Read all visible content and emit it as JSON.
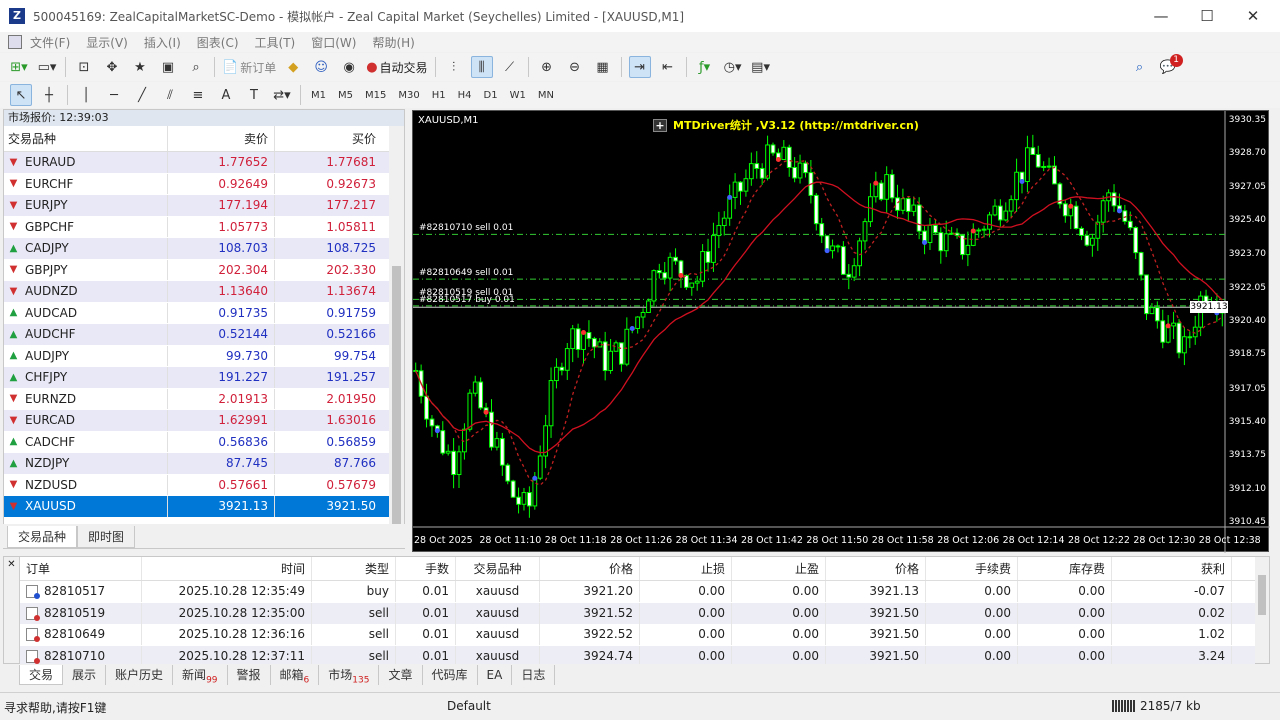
{
  "window": {
    "title": "500045169: ZealCapitalMarketSC-Demo - 模拟帐户 - Zeal Capital Market (Seychelles) Limited - [XAUUSD,M1]"
  },
  "menu": [
    "文件(F)",
    "显示(V)",
    "插入(I)",
    "图表(C)",
    "工具(T)",
    "窗口(W)",
    "帮助(H)"
  ],
  "toolbar": {
    "new_order": "新订单",
    "auto_trading": "自动交易"
  },
  "timeframes": [
    "M1",
    "M5",
    "M15",
    "M30",
    "H1",
    "H4",
    "D1",
    "W1",
    "MN"
  ],
  "market_watch": {
    "title": "市场报价: 12:39:03",
    "headers": {
      "symbol": "交易品种",
      "bid": "卖价",
      "ask": "买价"
    },
    "rows": [
      {
        "symbol": "EURAUD",
        "bid": "1.77652",
        "ask": "1.77681",
        "dir": "down",
        "color": "red"
      },
      {
        "symbol": "EURCHF",
        "bid": "0.92649",
        "ask": "0.92673",
        "dir": "down",
        "color": "red"
      },
      {
        "symbol": "EURJPY",
        "bid": "177.194",
        "ask": "177.217",
        "dir": "down",
        "color": "red"
      },
      {
        "symbol": "GBPCHF",
        "bid": "1.05773",
        "ask": "1.05811",
        "dir": "down",
        "color": "red"
      },
      {
        "symbol": "CADJPY",
        "bid": "108.703",
        "ask": "108.725",
        "dir": "up",
        "color": "blue"
      },
      {
        "symbol": "GBPJPY",
        "bid": "202.304",
        "ask": "202.330",
        "dir": "down",
        "color": "red"
      },
      {
        "symbol": "AUDNZD",
        "bid": "1.13640",
        "ask": "1.13674",
        "dir": "down",
        "color": "red"
      },
      {
        "symbol": "AUDCAD",
        "bid": "0.91735",
        "ask": "0.91759",
        "dir": "up",
        "color": "blue"
      },
      {
        "symbol": "AUDCHF",
        "bid": "0.52144",
        "ask": "0.52166",
        "dir": "up",
        "color": "blue"
      },
      {
        "symbol": "AUDJPY",
        "bid": "99.730",
        "ask": "99.754",
        "dir": "up",
        "color": "blue"
      },
      {
        "symbol": "CHFJPY",
        "bid": "191.227",
        "ask": "191.257",
        "dir": "up",
        "color": "blue"
      },
      {
        "symbol": "EURNZD",
        "bid": "2.01913",
        "ask": "2.01950",
        "dir": "down",
        "color": "red"
      },
      {
        "symbol": "EURCAD",
        "bid": "1.62991",
        "ask": "1.63016",
        "dir": "down",
        "color": "red"
      },
      {
        "symbol": "CADCHF",
        "bid": "0.56836",
        "ask": "0.56859",
        "dir": "up",
        "color": "blue"
      },
      {
        "symbol": "NZDJPY",
        "bid": "87.745",
        "ask": "87.766",
        "dir": "up",
        "color": "blue"
      },
      {
        "symbol": "NZDUSD",
        "bid": "0.57661",
        "ask": "0.57679",
        "dir": "down",
        "color": "red"
      },
      {
        "symbol": "XAUUSD",
        "bid": "3921.13",
        "ask": "3921.50",
        "dir": "down",
        "color": "sel"
      }
    ],
    "tabs": [
      "交易品种",
      "即时图"
    ]
  },
  "chart": {
    "label": "XAUUSD,M1",
    "indicator": "MTDriver统计 ,V3.12 (http://mtdriver.cn)",
    "current_price": "3921.13",
    "y_ticks": [
      "3930.35",
      "3928.70",
      "3927.05",
      "3925.40",
      "3923.70",
      "3922.05",
      "3920.40",
      "3918.75",
      "3917.05",
      "3915.40",
      "3913.75",
      "3912.10",
      "3910.45"
    ],
    "x_ticks": [
      "28 Oct 2025",
      "28 Oct 11:10",
      "28 Oct 11:18",
      "28 Oct 11:26",
      "28 Oct 11:34",
      "28 Oct 11:42",
      "28 Oct 11:50",
      "28 Oct 11:58",
      "28 Oct 12:06",
      "28 Oct 12:14",
      "28 Oct 12:22",
      "28 Oct 12:30",
      "28 Oct 12:38"
    ],
    "order_lines": [
      {
        "label": "#82810710 sell 0.01",
        "price": 3924.74
      },
      {
        "label": "#82810649 sell 0.01",
        "price": 3922.52
      },
      {
        "label": "#82810519 sell 0.01",
        "price": 3921.52
      },
      {
        "label": "#82810517 buy 0.01",
        "price": 3921.2
      }
    ]
  },
  "terminal": {
    "headers": [
      "订单",
      "时间",
      "类型",
      "手数",
      "交易品种",
      "价格",
      "止损",
      "止盈",
      "价格",
      "手续费",
      "库存费",
      "获利"
    ],
    "rows": [
      {
        "order": "82810517",
        "time": "2025.10.28 12:35:49",
        "type": "buy",
        "lots": "0.01",
        "symbol": "xauusd",
        "price": "3921.20",
        "sl": "0.00",
        "tp": "0.00",
        "cur": "3921.13",
        "comm": "0.00",
        "swap": "0.00",
        "profit": "-0.07"
      },
      {
        "order": "82810519",
        "time": "2025.10.28 12:35:00",
        "type": "sell",
        "lots": "0.01",
        "symbol": "xauusd",
        "price": "3921.52",
        "sl": "0.00",
        "tp": "0.00",
        "cur": "3921.50",
        "comm": "0.00",
        "swap": "0.00",
        "profit": "0.02"
      },
      {
        "order": "82810649",
        "time": "2025.10.28 12:36:16",
        "type": "sell",
        "lots": "0.01",
        "symbol": "xauusd",
        "price": "3922.52",
        "sl": "0.00",
        "tp": "0.00",
        "cur": "3921.50",
        "comm": "0.00",
        "swap": "0.00",
        "profit": "1.02"
      },
      {
        "order": "82810710",
        "time": "2025.10.28 12:37:11",
        "type": "sell",
        "lots": "0.01",
        "symbol": "xauusd",
        "price": "3924.74",
        "sl": "0.00",
        "tp": "0.00",
        "cur": "3921.50",
        "comm": "0.00",
        "swap": "0.00",
        "profit": "3.24"
      }
    ],
    "tabs": [
      {
        "label": "交易",
        "badge": ""
      },
      {
        "label": "展示",
        "badge": ""
      },
      {
        "label": "账户历史",
        "badge": ""
      },
      {
        "label": "新闻",
        "badge": "99"
      },
      {
        "label": "警报",
        "badge": ""
      },
      {
        "label": "邮箱",
        "badge": "6"
      },
      {
        "label": "市场",
        "badge": "135"
      },
      {
        "label": "文章",
        "badge": ""
      },
      {
        "label": "代码库",
        "badge": ""
      },
      {
        "label": "EA",
        "badge": ""
      },
      {
        "label": "日志",
        "badge": ""
      }
    ]
  },
  "status": {
    "help": "寻求帮助,请按F1键",
    "profile": "Default",
    "traffic": "2185/7 kb"
  },
  "notification_badge": "1"
}
